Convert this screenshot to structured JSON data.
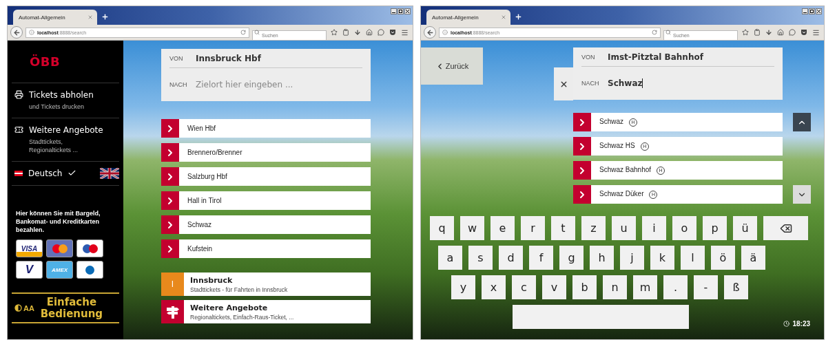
{
  "windows": [
    {
      "browser": {
        "tab_title": "Automat-Allgemein",
        "url_host": "localhost",
        "url_path": ":8888/search",
        "search_placeholder": "Suchen"
      },
      "screen": {
        "kind": "start",
        "sidebar": {
          "logo": "ÖBB",
          "menu": [
            {
              "kind": "print",
              "title": "Tickets abholen",
              "subtitle": "und Tickets drucken"
            },
            {
              "kind": "offers",
              "title": "Weitere Angebote",
              "subtitle": "Stadttickets, Regionaltickets ..."
            }
          ],
          "languages": [
            {
              "kind": "at",
              "label": "Deutsch",
              "selected": true
            },
            {
              "kind": "uk",
              "selected": false
            }
          ],
          "payment_note": "Hier können Sie mit Bargeld, Bankomat- und Kreditkarten bezahlen.",
          "cards": [
            {
              "kind": "visa",
              "label": "VISA"
            },
            {
              "kind": "mastercard"
            },
            {
              "kind": "maestro"
            },
            {
              "kind": "vpay",
              "label": "V"
            },
            {
              "kind": "amex",
              "label": "AMEX"
            },
            {
              "kind": "diners"
            }
          ],
          "easy_mode": {
            "icon_label": "AA",
            "label": "Einfache Bedienung"
          }
        },
        "route": {
          "from": {
            "label": "VON",
            "value": "Innsbruck Hbf"
          },
          "to": {
            "label": "NACH",
            "placeholder": "Zielort hier eingeben ..."
          }
        },
        "suggestions": [
          {
            "label": "Wien Hbf"
          },
          {
            "label": "Brennero/Brenner"
          },
          {
            "label": "Salzburg Hbf"
          },
          {
            "label": "Hall in Tirol"
          },
          {
            "label": "Schwaz"
          },
          {
            "label": "Kufstein"
          }
        ],
        "offers": [
          {
            "kind": "city",
            "badge": "I",
            "color": "#e8891c",
            "title": "Innsbruck",
            "subtitle": "Stadttickets - für Fahrten in Innsbruck"
          },
          {
            "kind": "more",
            "color": "#c3002f",
            "title": "Weitere Angebote",
            "subtitle": "Regionaltickets, Einfach-Raus-Ticket, ..."
          }
        ]
      }
    },
    {
      "browser": {
        "tab_title": "Automat-Allgemein",
        "url_host": "localhost",
        "url_path": ":8888/search",
        "search_placeholder": "Suchen"
      },
      "screen": {
        "kind": "search",
        "back_button": "Zurück",
        "route": {
          "from": {
            "label": "VON",
            "value": "Imst-Pitztal Bahnhof"
          },
          "to": {
            "label": "NACH",
            "value": "Schwaz",
            "focused": true
          }
        },
        "results": [
          {
            "label": "Schwaz",
            "badge": "H"
          },
          {
            "label": "Schwaz HS",
            "badge": "H"
          },
          {
            "label": "Schwaz Bahnhof",
            "badge": "H"
          },
          {
            "label": "Schwaz Düker",
            "badge": "H"
          }
        ],
        "scroll_buttons": [
          {
            "kind": "up",
            "highlighted": true
          },
          {
            "kind": "down",
            "highlighted": false
          }
        ],
        "keyboard": {
          "rows": [
            [
              {
                "kind": "char",
                "label": "q"
              },
              {
                "kind": "char",
                "label": "w"
              },
              {
                "kind": "char",
                "label": "e"
              },
              {
                "kind": "char",
                "label": "r"
              },
              {
                "kind": "char",
                "label": "t"
              },
              {
                "kind": "char",
                "label": "z"
              },
              {
                "kind": "char",
                "label": "u"
              },
              {
                "kind": "char",
                "label": "i"
              },
              {
                "kind": "char",
                "label": "o"
              },
              {
                "kind": "char",
                "label": "p"
              },
              {
                "kind": "char",
                "label": "ü"
              },
              {
                "kind": "backspace"
              }
            ],
            [
              {
                "kind": "char",
                "label": "a"
              },
              {
                "kind": "char",
                "label": "s"
              },
              {
                "kind": "char",
                "label": "d"
              },
              {
                "kind": "char",
                "label": "f"
              },
              {
                "kind": "char",
                "label": "g"
              },
              {
                "kind": "char",
                "label": "h"
              },
              {
                "kind": "char",
                "label": "j"
              },
              {
                "kind": "char",
                "label": "k"
              },
              {
                "kind": "char",
                "label": "l"
              },
              {
                "kind": "char",
                "label": "ö"
              },
              {
                "kind": "char",
                "label": "ä"
              }
            ],
            [
              {
                "kind": "char",
                "label": "y"
              },
              {
                "kind": "char",
                "label": "x"
              },
              {
                "kind": "char",
                "label": "c"
              },
              {
                "kind": "char",
                "label": "v"
              },
              {
                "kind": "char",
                "label": "b"
              },
              {
                "kind": "char",
                "label": "n"
              },
              {
                "kind": "char",
                "label": "m"
              },
              {
                "kind": "char",
                "label": "."
              },
              {
                "kind": "char",
                "label": "-"
              },
              {
                "kind": "char",
                "label": "ß"
              }
            ],
            [
              {
                "kind": "space"
              }
            ]
          ]
        },
        "clock": "18:23"
      }
    }
  ]
}
